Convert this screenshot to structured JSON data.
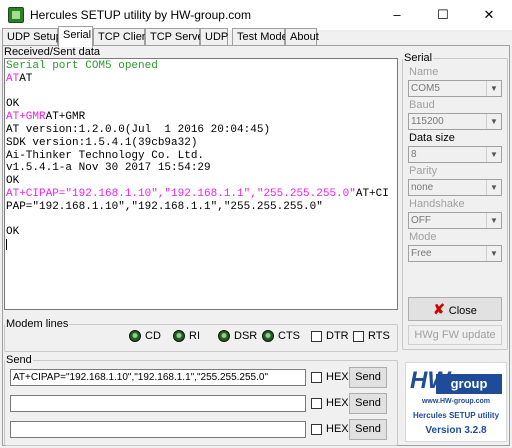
{
  "window": {
    "title": "Hercules SETUP utility by HW-group.com",
    "minimize": "–",
    "maximize": "☐",
    "close": "✕"
  },
  "tabs": [
    "UDP Setup",
    "Serial",
    "TCP Client",
    "TCP Server",
    "UDP",
    "Test Mode",
    "About"
  ],
  "active_tab": "Serial",
  "log": {
    "label": "Received/Sent data",
    "lines": [
      {
        "parts": [
          {
            "c": "green",
            "t": "Serial port COM5 opened"
          }
        ]
      },
      {
        "parts": [
          {
            "c": "magenta",
            "t": "AT"
          },
          {
            "c": "black",
            "t": "AT"
          }
        ]
      },
      {
        "parts": []
      },
      {
        "parts": [
          {
            "c": "black",
            "t": "OK"
          }
        ]
      },
      {
        "parts": [
          {
            "c": "magenta",
            "t": "AT+GMR"
          },
          {
            "c": "black",
            "t": "AT+GMR"
          }
        ]
      },
      {
        "parts": [
          {
            "c": "black",
            "t": "AT version:1.2.0.0(Jul  1 2016 20:04:45)"
          }
        ]
      },
      {
        "parts": [
          {
            "c": "black",
            "t": "SDK version:1.5.4.1(39cb9a32)"
          }
        ]
      },
      {
        "parts": [
          {
            "c": "black",
            "t": "Ai-Thinker Technology Co. Ltd."
          }
        ]
      },
      {
        "parts": [
          {
            "c": "black",
            "t": "v1.5.4.1-a Nov 30 2017 15:54:29"
          }
        ]
      },
      {
        "parts": [
          {
            "c": "black",
            "t": "OK"
          }
        ]
      },
      {
        "parts": [
          {
            "c": "magenta",
            "t": "AT+CIPAP=\"192.168.1.10\",\"192.168.1.1\",\"255.255.255.0\""
          },
          {
            "c": "black",
            "t": "AT+CI"
          }
        ]
      },
      {
        "parts": [
          {
            "c": "black",
            "t": "PAP=\"192.168.1.10\",\"192.168.1.1\",\"255.255.255.0\""
          }
        ]
      },
      {
        "parts": []
      },
      {
        "parts": [
          {
            "c": "black",
            "t": "OK"
          }
        ]
      }
    ]
  },
  "serial": {
    "legend": "Serial",
    "name_label": "Name",
    "name_value": "COM5",
    "baud_label": "Baud",
    "baud_value": "115200",
    "data_size_label": "Data size",
    "data_size_value": "8",
    "parity_label": "Parity",
    "parity_value": "none",
    "handshake_label": "Handshake",
    "handshake_value": "OFF",
    "mode_label": "Mode",
    "mode_value": "Free",
    "close_label": "Close",
    "hwg_label": "HWg FW update"
  },
  "modem": {
    "legend": "Modem lines",
    "leds": [
      "CD",
      "RI",
      "DSR",
      "CTS"
    ],
    "checks": [
      "DTR",
      "RTS"
    ]
  },
  "send": {
    "legend": "Send",
    "rows": [
      {
        "value": "AT+CIPAP=\"192.168.1.10\",\"192.168.1.1\",\"255.255.255.0\"",
        "hex": "HEX",
        "button": "Send"
      },
      {
        "value": "",
        "hex": "HEX",
        "button": "Send"
      },
      {
        "value": "",
        "hex": "HEX",
        "button": "Send"
      }
    ]
  },
  "logo": {
    "hw": "HW",
    "group": "group",
    "url": "www.HW-group.com",
    "app": "Hercules SETUP utility",
    "version": "Version  3.2.8"
  },
  "colors": {
    "received": "#2a9d2a",
    "sent": "#ee22ee",
    "brand": "#1f4c99",
    "close_x": "#cc0000"
  }
}
